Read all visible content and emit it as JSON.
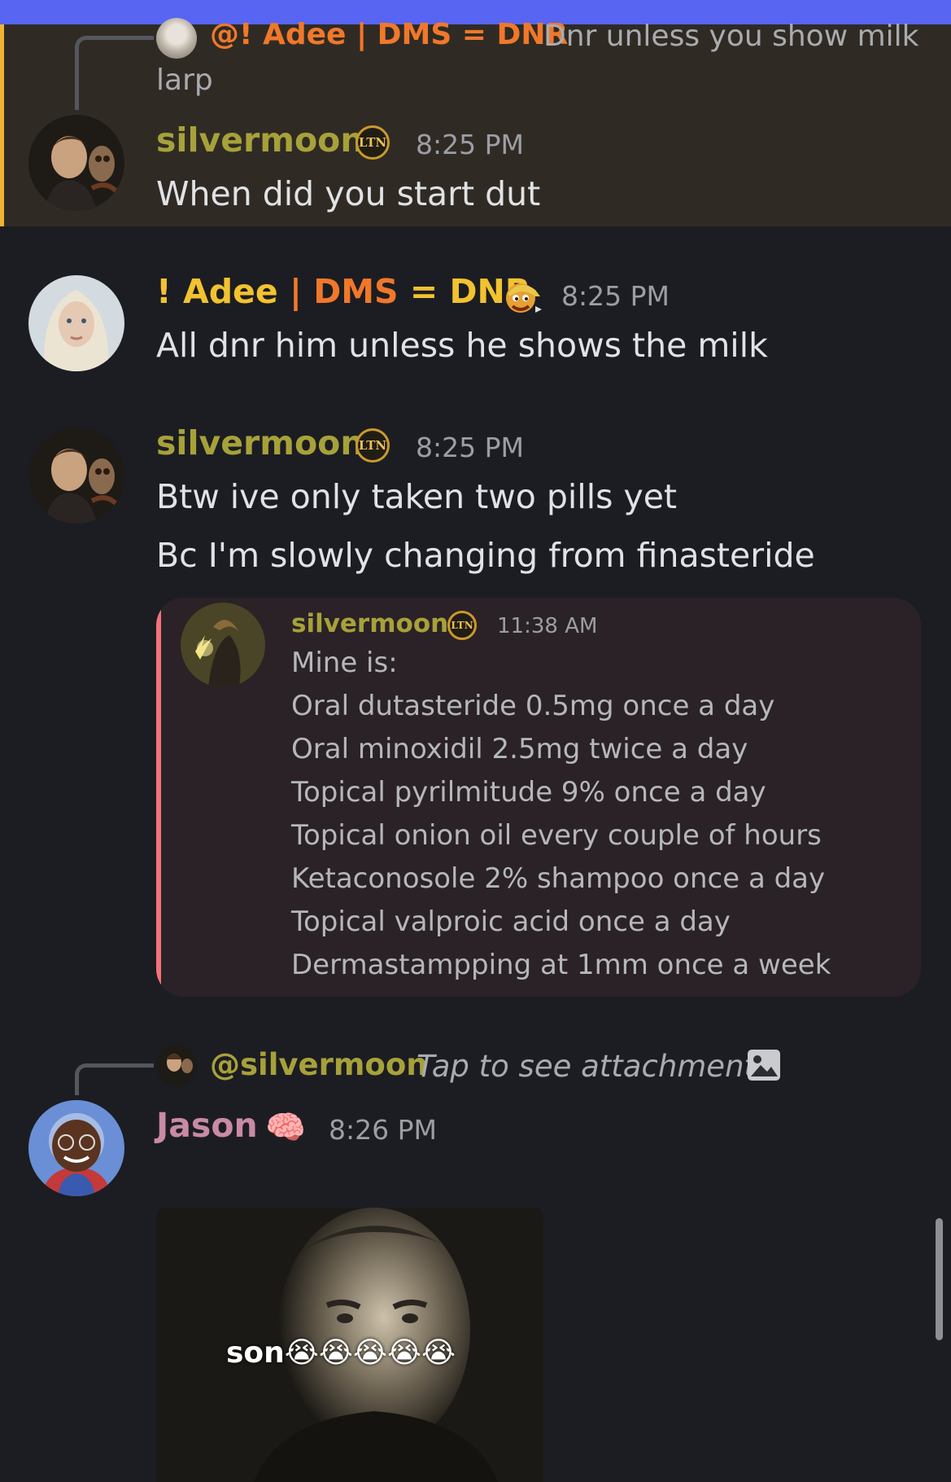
{
  "colors": {
    "accent": "#5865f2",
    "highlight_bg": "#2f2b24",
    "highlight_bar": "#f0b232",
    "silvermoon_name": "#a7a13a",
    "adee_orange": "#f0782b",
    "adee_yellow": "#f2c230",
    "jason_name": "#c88aa5",
    "quote_bar": "#f2737a",
    "timestamp": "#9b9ea5"
  },
  "messages": {
    "m1": {
      "reply_mention": "@! Adee | DMS = DNR",
      "reply_text_line1": "Dnr unless you show milk",
      "reply_text_line2": "larp",
      "author": "silvermoon",
      "badge": "LTN",
      "time": "8:25 PM",
      "text": "When did you start dut"
    },
    "m2": {
      "author_part1": "! Adee",
      "author_sep": "|",
      "author_part2": "DMS",
      "author_eq": "=",
      "author_part3": "DNR",
      "badge_icon": "cartoon-face-icon",
      "time": "8:25 PM",
      "text": "All dnr him unless he shows the milk"
    },
    "m3": {
      "author": "silvermoon",
      "badge": "LTN",
      "time": "8:25 PM",
      "line1": "Btw ive only taken two pills yet",
      "line2": "Bc I'm slowly changing from finasteride",
      "quoted": {
        "author": "silvermoon",
        "badge": "LTN",
        "time": "11:38 AM",
        "lines": [
          "Mine is:",
          "Oral dutasteride 0.5mg once a day",
          "Oral minoxidil 2.5mg twice a day",
          "Topical pyrilmitude 9% once a  day",
          "Topical onion oil every couple of hours",
          "Ketaconosole 2% shampoo once a day",
          "Topical valproic acid once a day",
          "Dermastampping at 1mm once a week"
        ]
      }
    },
    "m4": {
      "reply_mention": "@silvermoon",
      "reply_text": "Tap to see attachment",
      "author": "Jason",
      "badge_icon": "brain-icon",
      "badge_glyph": "🧠",
      "time": "8:26 PM",
      "attachment_caption": "son😭😭😭😭😭"
    }
  }
}
